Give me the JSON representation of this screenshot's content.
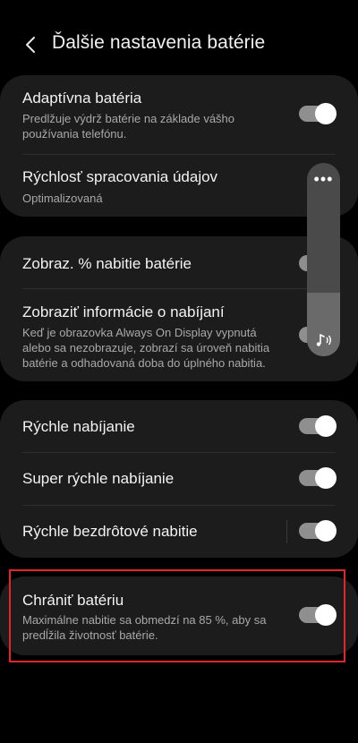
{
  "header": {
    "title": "Ďalšie nastavenia batérie"
  },
  "sections": {
    "card1": {
      "adaptive": {
        "label": "Adaptívna batéria",
        "sub": "Predlžuje výdrž batérie na základe vášho používania telefónu.",
        "toggle_on": true
      },
      "processing": {
        "label": "Rýchlosť spracovania údajov",
        "sub": "Optimalizovaná"
      }
    },
    "card2": {
      "percent": {
        "label": "Zobraz. % nabitie batérie",
        "toggle_on": true
      },
      "charging_info": {
        "label": "Zobraziť informácie o nabíjaní",
        "sub": "Keď je obrazovka Always On Display vypnutá alebo sa nezobrazuje, zobrazí sa úroveň nabitia batérie a odhadovaná doba do úplného nabitia.",
        "toggle_on": true
      }
    },
    "card3": {
      "fast": {
        "label": "Rýchle nabíjanie",
        "toggle_on": true
      },
      "super_fast": {
        "label": "Super rýchle nabíjanie",
        "toggle_on": true
      },
      "wireless": {
        "label": "Rýchle bezdrôtové nabitie",
        "toggle_on": true
      }
    },
    "card4": {
      "protect": {
        "label": "Chrániť batériu",
        "sub": "Maximálne nabitie sa obmedzí na 85 %, aby sa predĺžila životnosť batérie.",
        "toggle_on": true
      }
    }
  },
  "volume_panel": {
    "more_glyph": "•••",
    "level_fraction": 0.33,
    "icon": "media-volume-icon"
  },
  "colors": {
    "highlight": "#e0262a",
    "toggle_track": "#8f8f8f",
    "card": "#1c1c1c"
  }
}
